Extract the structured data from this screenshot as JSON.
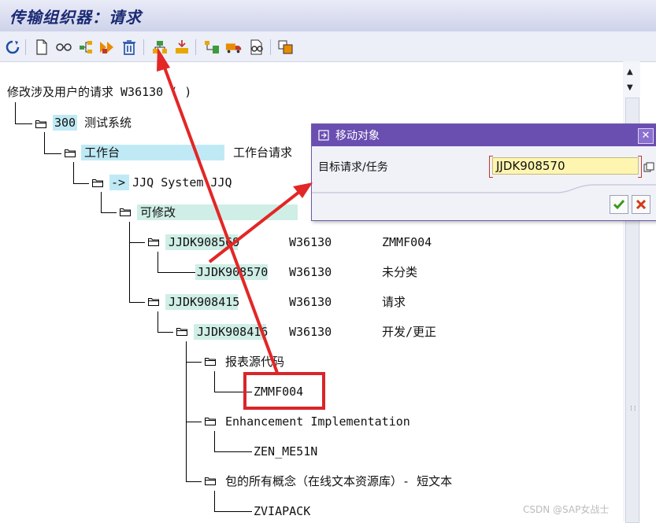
{
  "window": {
    "title": "传输组织器：请求"
  },
  "toolbar": {
    "icons": [
      "refresh-icon",
      "new-document-icon",
      "display-change-icon",
      "hierarchy-icon",
      "sequence-icon",
      "delete-icon",
      "move-object-icon",
      "merge-icon",
      "assign-icon",
      "transport-icon",
      "inspect-icon",
      "copy-icon"
    ]
  },
  "tree": {
    "root": "修改涉及用户的请求 W36130 ( )",
    "system_code": "300",
    "system_name": "测试系统",
    "workbench": "工作台",
    "workbench_desc": "工作台请求",
    "owner": "-> JJQ System JJQ",
    "modifiable": "可修改",
    "rows": [
      {
        "request": "JJDK908569",
        "user": "W36130",
        "desc": "ZMMF004"
      },
      {
        "request": "JJDK908570",
        "user": "W36130",
        "desc": "未分类"
      },
      {
        "request": "JJDK908415",
        "user": "W36130",
        "desc": "请求"
      },
      {
        "request": "JJDK908416",
        "user": "W36130",
        "desc": "开发/更正"
      }
    ],
    "objects": [
      {
        "type": "报表源代码",
        "name": "ZMMF004"
      },
      {
        "type": "Enhancement Implementation",
        "name": "ZEN_ME51N"
      },
      {
        "type": "包的所有概念（在线文本资源库）- 短文本",
        "name": "ZVIAPACK"
      }
    ]
  },
  "dialog": {
    "title": "移动对象",
    "field_label": "目标请求/任务",
    "field_value": "JJDK908570",
    "ok_icon": "check-icon",
    "cancel_icon": "cancel-icon"
  },
  "annotation": {
    "arrow_color": "#e32626",
    "box_color": "#d9252b"
  },
  "watermark": "CSDN @SAP女战士"
}
